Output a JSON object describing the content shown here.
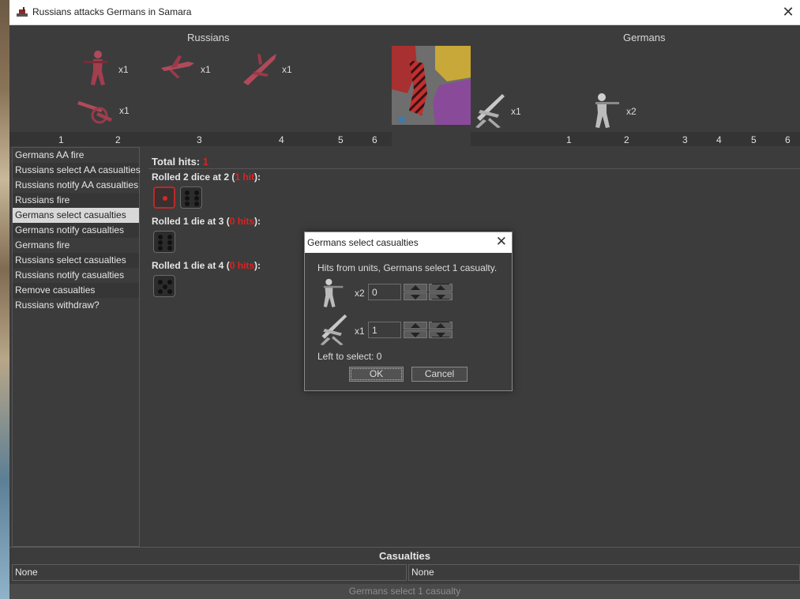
{
  "window": {
    "title": "Russians attacks Germans in Samara",
    "close_glyph": "✕"
  },
  "attacker": {
    "name": "Russians",
    "units": [
      {
        "icon": "infantry-icon",
        "count": "x1"
      },
      {
        "icon": "fighter-icon",
        "count": "x1"
      },
      {
        "icon": "bomber-icon",
        "count": "x1"
      },
      {
        "icon": "artillery-icon",
        "count": "x1"
      }
    ],
    "columns": [
      "1",
      "2",
      "3",
      "4",
      "5",
      "6"
    ]
  },
  "defender": {
    "name": "Germans",
    "units": [
      {
        "icon": "aa-gun-icon",
        "count": "x1"
      },
      {
        "icon": "infantry-icon",
        "count": "x2"
      }
    ],
    "columns": [
      "1",
      "2",
      "3",
      "4",
      "5",
      "6"
    ]
  },
  "steps": [
    "Germans AA fire",
    "Russians select AA casualties",
    "Russians notify AA casualties",
    "Russians fire",
    "Germans select casualties",
    "Germans notify casualties",
    "Germans fire",
    "Russians select casualties",
    "Russians notify casualties",
    "Remove casualties",
    "Russians withdraw?"
  ],
  "selected_step": "Germans select casualties",
  "results": {
    "total_label": "Total hits: ",
    "total_value": "1",
    "rolls": [
      {
        "prefix": "Rolled 2 dice at 2 (",
        "hits": "1 hit",
        "suffix": "):",
        "dice": [
          1,
          6
        ]
      },
      {
        "prefix": "Rolled 1 die at 3 (",
        "hits": "0 hits",
        "suffix": "):",
        "dice": [
          6
        ]
      },
      {
        "prefix": "Rolled 1 die at 4 (",
        "hits": "0 hits",
        "suffix": "):",
        "dice": [
          5
        ]
      }
    ]
  },
  "dialog": {
    "title": "Germans select casualties",
    "message": "Hits from units,  Germans select 1 casualty.",
    "rows": [
      {
        "icon": "infantry-icon",
        "count": "x2",
        "value": "0"
      },
      {
        "icon": "aa-gun-icon",
        "count": "x1",
        "value": "1"
      }
    ],
    "left_label": "Left to select: 0",
    "ok": "OK",
    "cancel": "Cancel"
  },
  "casualties": {
    "header": "Casualties",
    "attacker": "None",
    "defender": "None"
  },
  "status": "Germans select 1 casualty",
  "colors": {
    "russian_unit": "#b04a5a",
    "german_unit": "#c8c8c8",
    "hit_red": "#e02020",
    "selected_step_bg": "#d8d8d8"
  }
}
